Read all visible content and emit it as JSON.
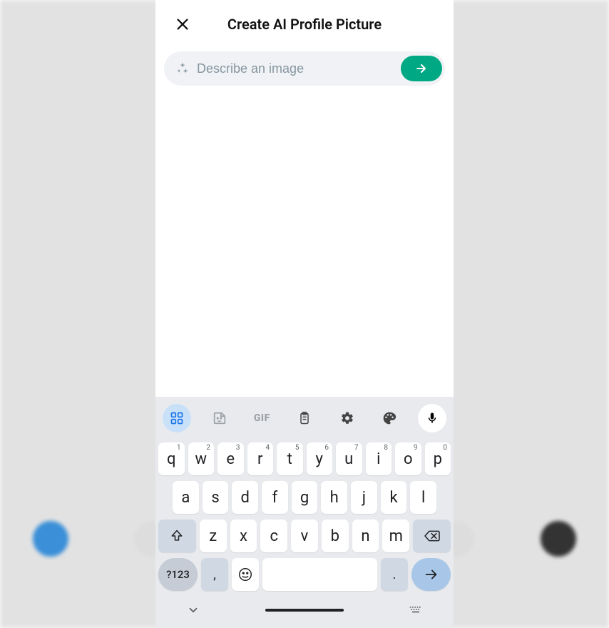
{
  "header": {
    "title": "Create AI Profile Picture"
  },
  "prompt": {
    "placeholder": "Describe an image",
    "value": ""
  },
  "keyboard": {
    "suggestion_bar": {
      "icons": [
        "apps",
        "sticker",
        "gif",
        "clipboard",
        "settings",
        "palette",
        "mic"
      ],
      "gif_label": "GIF"
    },
    "rows": {
      "r1": [
        {
          "k": "q",
          "n": "1"
        },
        {
          "k": "w",
          "n": "2"
        },
        {
          "k": "e",
          "n": "3"
        },
        {
          "k": "r",
          "n": "4"
        },
        {
          "k": "t",
          "n": "5"
        },
        {
          "k": "y",
          "n": "6"
        },
        {
          "k": "u",
          "n": "7"
        },
        {
          "k": "i",
          "n": "8"
        },
        {
          "k": "o",
          "n": "9"
        },
        {
          "k": "p",
          "n": "0"
        }
      ],
      "r2": [
        "a",
        "s",
        "d",
        "f",
        "g",
        "h",
        "j",
        "k",
        "l"
      ],
      "r3": [
        "z",
        "x",
        "c",
        "v",
        "b",
        "n",
        "m"
      ]
    },
    "bottom": {
      "sym": "?123",
      "comma": ",",
      "period": "."
    }
  },
  "colors": {
    "accent": "#00a884",
    "kb_active": "#c8e1f9",
    "enter": "#a8c7e8"
  }
}
